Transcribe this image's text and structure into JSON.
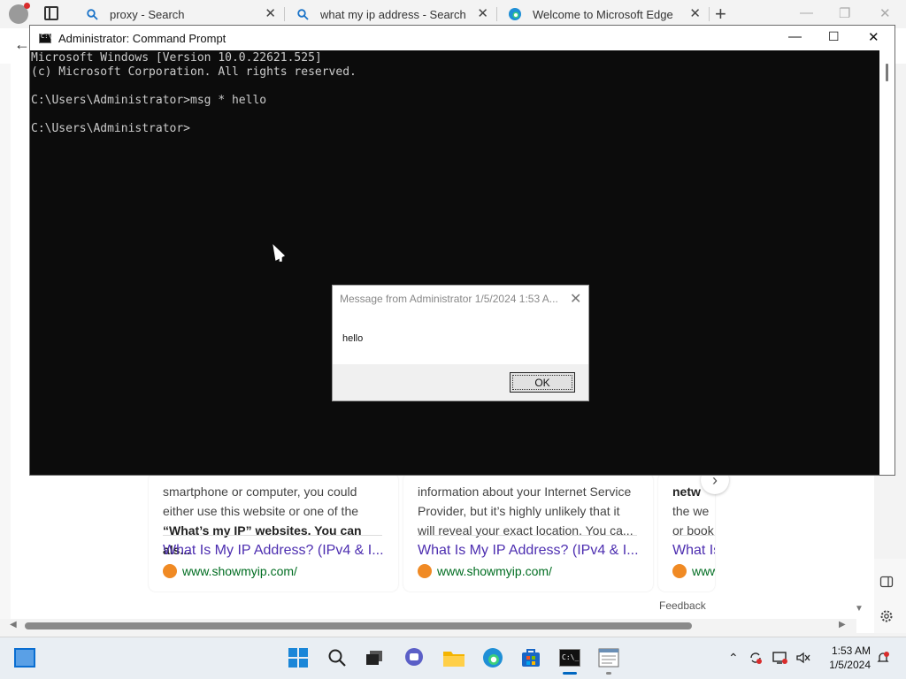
{
  "browser": {
    "tabs": [
      {
        "title": "proxy - Search",
        "icon": "search-icon"
      },
      {
        "title": "what my ip address - Search",
        "icon": "search-icon"
      },
      {
        "title": "Welcome to Microsoft Edge",
        "icon": "edge-icon"
      }
    ],
    "accent": "#0067c0"
  },
  "page": {
    "results": [
      {
        "snippet_lines": [
          "smartphone or computer, you could",
          "either use this website or one of the",
          "“What’s my IP” websites. You can als..."
        ],
        "title": "What Is My IP Address? (IPv4 & I...",
        "url": "www.showmyip.com/"
      },
      {
        "snippet_lines": [
          "information about your Internet Service",
          "Provider, but it’s highly unlikely that it",
          "will reveal your exact location. You ca..."
        ],
        "title": "What Is My IP Address? (IPv4 & I...",
        "url": "www.showmyip.com/"
      },
      {
        "snippet_lines": [
          "netw",
          "the we",
          "or book"
        ],
        "title": "What Is",
        "url": "www"
      }
    ],
    "feedback": "Feedback"
  },
  "cmd": {
    "title": "Administrator: Command Prompt",
    "lines": [
      "Microsoft Windows [Version 10.0.22621.525]",
      "(c) Microsoft Corporation. All rights reserved.",
      "",
      "C:\\Users\\Administrator>msg * hello",
      "",
      "C:\\Users\\Administrator>"
    ],
    "background": "#0c0c0c",
    "text_color": "#cccccc"
  },
  "msgbox": {
    "title": "Message from Administrator 1/5/2024 1:53 A...",
    "message": "hello",
    "ok_label": "OK"
  },
  "taskbar": {
    "apps": [
      "start-icon",
      "search-icon",
      "task-view-icon",
      "chat-icon",
      "file-explorer-icon",
      "edge-icon",
      "store-icon",
      "command-prompt-icon",
      "notepad-icon"
    ],
    "clock": {
      "time": "1:53 AM",
      "date": "1/5/2024"
    }
  }
}
